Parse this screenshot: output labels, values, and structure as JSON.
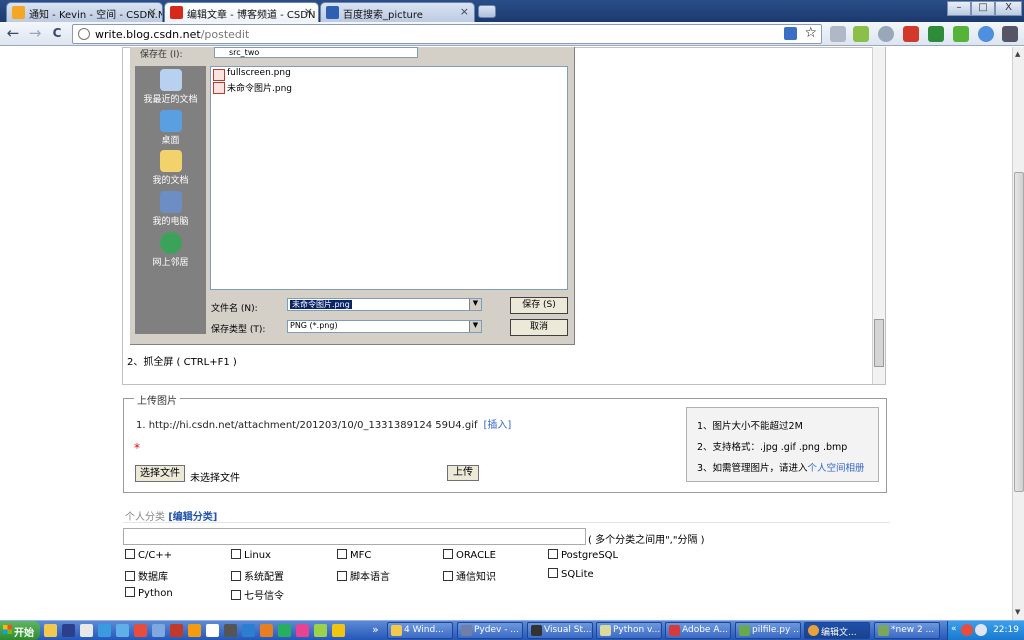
{
  "browser": {
    "tabs": [
      {
        "title": "通知 - Kevin - 空间 - CSDN.NE",
        "close": "×",
        "icon_color": "#f5a623"
      },
      {
        "title": "编辑文章 - 博客频道 - CSDN",
        "close": "×",
        "icon_color": "#d7281c"
      },
      {
        "title": "百度搜索_picture",
        "close": "×",
        "icon_color": "#2f5fb3"
      }
    ],
    "window_controls": {
      "minimize": "–",
      "maximize": "□",
      "close": "X"
    },
    "nav": {
      "back": "←",
      "forward": "→",
      "reload": "C"
    },
    "url_host": "write.blog.csdn.net",
    "url_path": "/postedit",
    "bookmark_star": "☆"
  },
  "dialog": {
    "lookin_label": "保存在 (I):",
    "lookin_value": "src_two",
    "places": [
      "我最近的文档",
      "桌面",
      "我的文档",
      "我的电脑",
      "网上邻居"
    ],
    "files": [
      "fullscreen.png",
      "未命令图片.png"
    ],
    "filename_label": "文件名 (N):",
    "filename_value": "未命令图片.png",
    "filetype_label": "保存类型 (T):",
    "filetype_value": "PNG (*.png)",
    "save_button": "保存 (S)",
    "cancel_button": "取消"
  },
  "editor": {
    "line2": "2、抓全屏 ( CTRL+F1 )"
  },
  "upload": {
    "legend": "上传图片",
    "attachment": "1.  http://hi.csdn.net/attachment/201203/10/0_1331389124 59U4.gif",
    "insert_link": "[插入]",
    "required_mark": "*",
    "choose_file": "选择文件",
    "no_file": "未选择文件",
    "upload_button": "上传",
    "tips": [
      "1、图片大小不能超过2M",
      "2、支持格式：.jpg .gif .png .bmp",
      "3、如需管理图片，请进入"
    ],
    "tips_link": "个人空间相册"
  },
  "category": {
    "label": "个人分类",
    "edit_link": "[编辑分类]",
    "hint": "( 多个分类之间用\",\"分隔 )",
    "checkboxes": [
      [
        "C/C++",
        "Linux",
        "MFC",
        "ORACLE",
        "PostgreSQL"
      ],
      [
        "数据库",
        "系统配置",
        "脚本语言",
        "通信知识",
        "SQLite"
      ],
      [
        "Python",
        "七号信令"
      ]
    ]
  },
  "taskbar": {
    "start": "开始",
    "overflow": "»",
    "buttons": [
      {
        "label": "4 Wind...",
        "icon_color": "#f2c94c"
      },
      {
        "label": "Pydev - ...",
        "icon_color": "#6f7fa8"
      },
      {
        "label": "Visual St...",
        "icon_color": "#333333"
      },
      {
        "label": "Python v...",
        "icon_color": "#d9d9a0"
      },
      {
        "label": "Adobe A...",
        "icon_color": "#d63b3b"
      },
      {
        "label": "pilfile.py ...",
        "icon_color": "#6aa84f"
      },
      {
        "label": "编辑文...",
        "icon_color": "#e7a23a"
      },
      {
        "label": "*new 2 ...",
        "icon_color": "#7aa75d"
      }
    ],
    "tray_chevron": "«",
    "clock": "22:19"
  }
}
